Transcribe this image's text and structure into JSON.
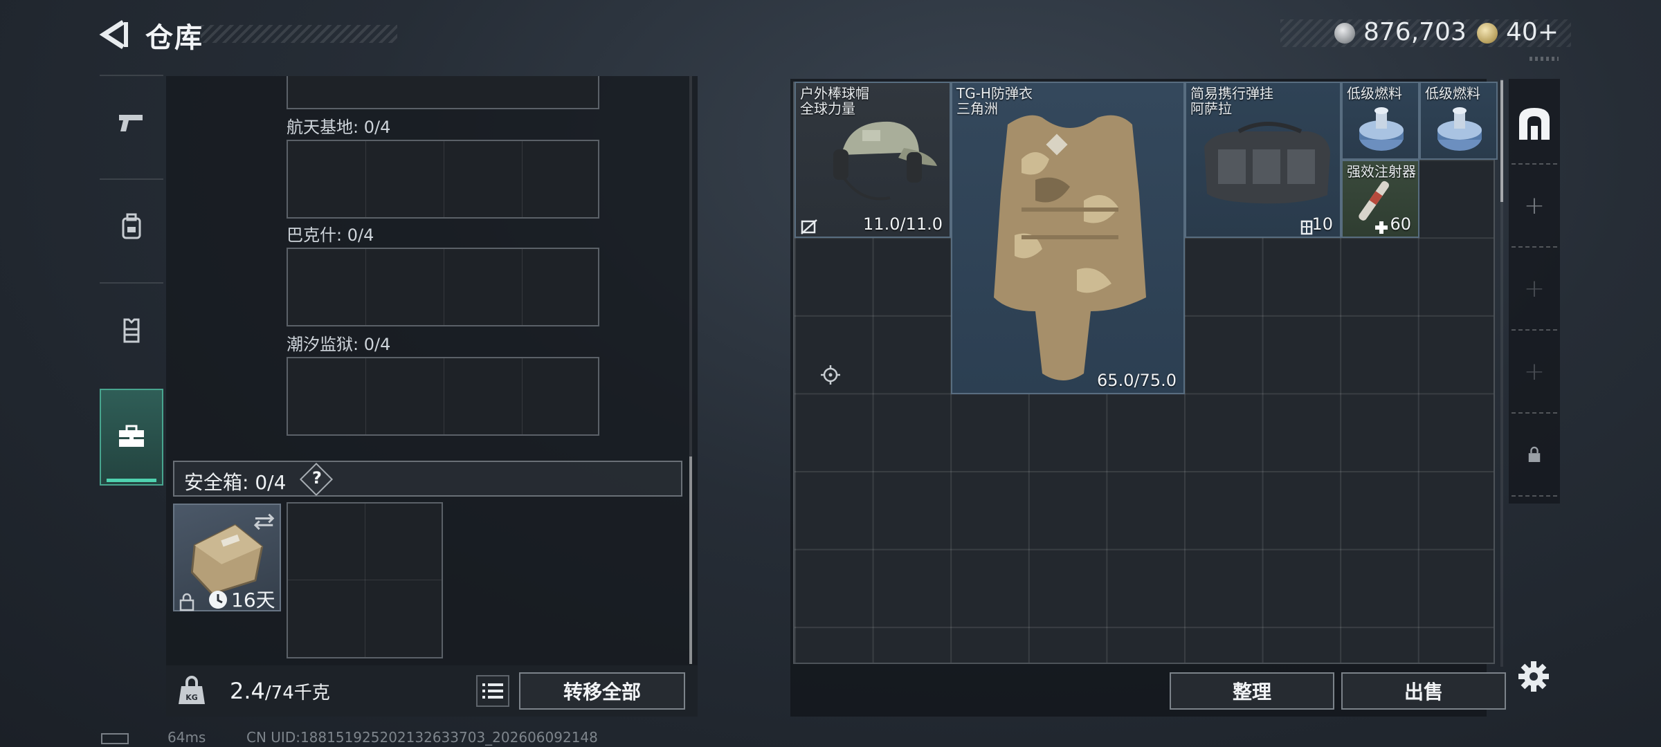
{
  "header": {
    "title": "仓库",
    "money": "876,703",
    "gold": "40",
    "gold_add": "+"
  },
  "sidebar": {
    "tabs": [
      {
        "icon": "pistol-icon"
      },
      {
        "icon": "backpack-icon"
      },
      {
        "icon": "vest-icon"
      },
      {
        "icon": "briefcase-icon",
        "active": true
      }
    ]
  },
  "storage": {
    "slots": [
      {
        "label": "航天基地: 0/4"
      },
      {
        "label": "巴克什: 0/4"
      },
      {
        "label": "潮汐监狱: 0/4"
      }
    ],
    "safe_box": {
      "label": "安全箱: 0/4",
      "help": "?",
      "timer": "16天"
    },
    "weight": {
      "current": "2.4",
      "max": "/74千克"
    },
    "transfer_all_label": "转移全部"
  },
  "inventory": {
    "items": [
      {
        "name_line1": "户外棒球帽",
        "name_line2": "全球力量",
        "value": "11.0/11.0"
      },
      {
        "name_line1": "TG-H防弹衣",
        "name_line2": "三角洲",
        "value": "65.0/75.0"
      },
      {
        "name_line1": "简易携行弹挂",
        "name_line2": "阿萨拉",
        "value": "10"
      },
      {
        "name_line1": "低级燃料",
        "name_line2": ""
      },
      {
        "name_line1": "低级燃料",
        "name_line2": ""
      },
      {
        "name_line1": "强效注射器",
        "name_line2": "",
        "value": "60"
      }
    ],
    "sort_label": "整理",
    "sell_label": "出售"
  },
  "status": {
    "ping": "64ms",
    "uid": "CN UID:1881519252021326337​03_202606092148"
  },
  "colors": {
    "accent": "#4fd3b0",
    "item_highlight": "#2f4356"
  }
}
